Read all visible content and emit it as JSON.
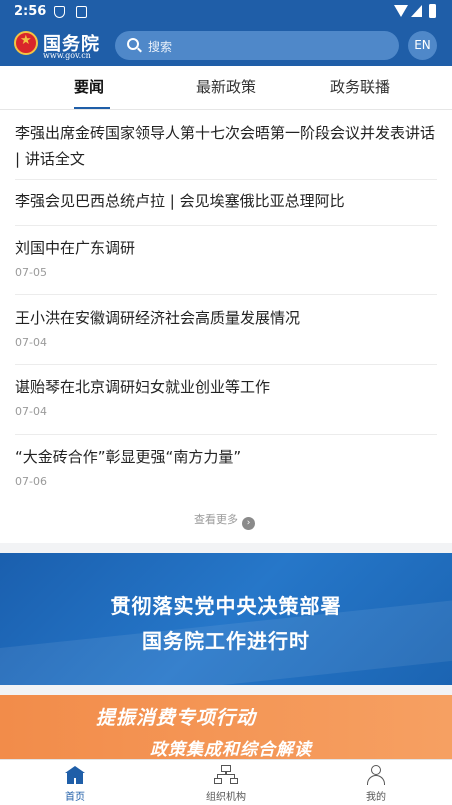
{
  "status_bar": {
    "time": "2:56"
  },
  "header": {
    "brand": "国务院",
    "brand_url": "www.gov.cn",
    "search_placeholder": "搜索",
    "lang_button": "EN",
    "colors": {
      "primary": "#1f5ea8",
      "search_bg": "#4f88c9"
    }
  },
  "tabs": [
    {
      "label": "要闻",
      "active": true
    },
    {
      "label": "最新政策",
      "active": false
    },
    {
      "label": "政务联播",
      "active": false
    }
  ],
  "news": [
    {
      "title": "李强出席金砖国家领导人第十七次会晤第一阶段会议并发表讲话 | 讲话全文",
      "date": ""
    },
    {
      "title": "李强会见巴西总统卢拉 | 会见埃塞俄比亚总理阿比",
      "date": ""
    },
    {
      "title": "刘国中在广东调研",
      "date": "07-05"
    },
    {
      "title": "王小洪在安徽调研经济社会高质量发展情况",
      "date": "07-04"
    },
    {
      "title": "谌贻琴在北京调研妇女就业创业等工作",
      "date": "07-04"
    },
    {
      "title": "“大金砖合作”彰显更强“南方力量”",
      "date": "07-06"
    }
  ],
  "more_label": "查看更多",
  "banners": {
    "banner1": {
      "line1": "贯彻落实党中央决策部署",
      "line2": "国务院工作进行时"
    },
    "banner2": {
      "line1": "提振消费专项行动",
      "line2": "政策集成和综合解读"
    }
  },
  "bottom_nav": [
    {
      "label": "首页",
      "icon": "home-icon",
      "active": true
    },
    {
      "label": "组织机构",
      "icon": "org-chart-icon",
      "active": false
    },
    {
      "label": "我的",
      "icon": "user-icon",
      "active": false
    }
  ]
}
